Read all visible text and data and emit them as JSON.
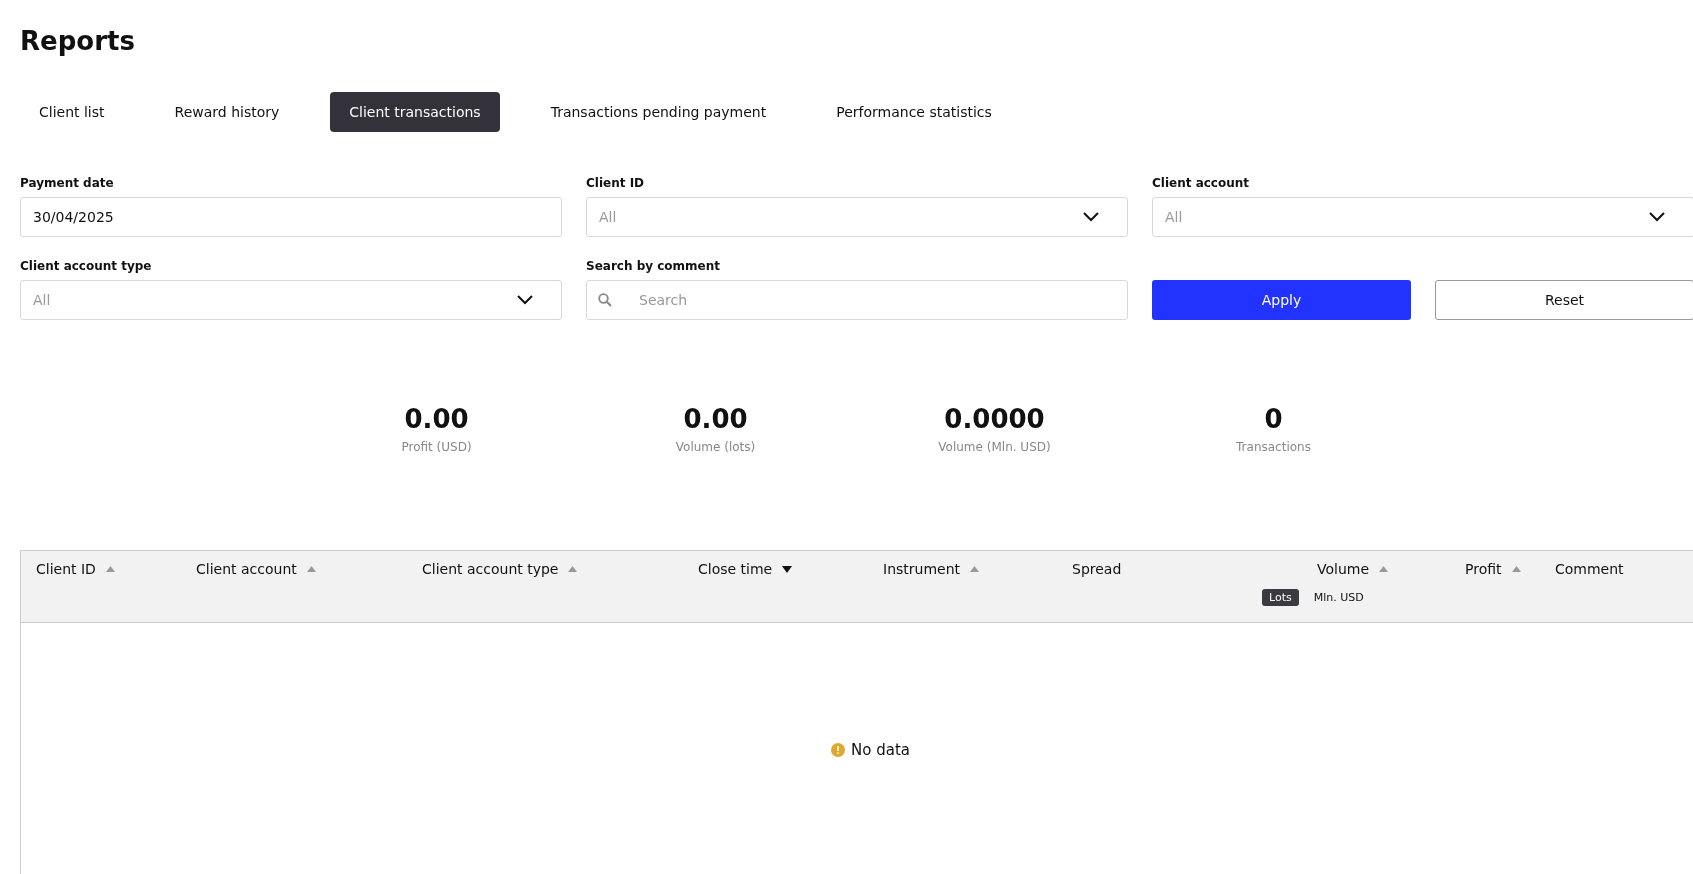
{
  "page_title": "Reports",
  "tabs": [
    {
      "label": "Client list",
      "selected": false
    },
    {
      "label": "Reward history",
      "selected": false
    },
    {
      "label": "Client transactions",
      "selected": true
    },
    {
      "label": "Transactions pending payment",
      "selected": false
    },
    {
      "label": "Performance statistics",
      "selected": false
    }
  ],
  "filters": [
    {
      "kind": "text",
      "label": "Payment date",
      "value": "30/04/2025"
    },
    {
      "kind": "select",
      "label": "Client ID",
      "placeholder": "All"
    },
    {
      "kind": "select",
      "label": "Client account",
      "placeholder": "All"
    },
    {
      "kind": "select",
      "label": "Client account type",
      "placeholder": "All"
    },
    {
      "kind": "search",
      "label": "Search by comment",
      "placeholder": "Search"
    }
  ],
  "buttons": [
    {
      "kind": "primary",
      "label": "Apply"
    },
    {
      "kind": "secondary",
      "label": "Reset"
    }
  ],
  "stats": [
    {
      "value": "0.00",
      "label": "Profit (USD)"
    },
    {
      "value": "0.00",
      "label": "Volume (lots)"
    },
    {
      "value": "0.0000",
      "label": "Volume (Mln. USD)"
    },
    {
      "value": "0",
      "label": "Transactions"
    }
  ],
  "table": {
    "columns": [
      {
        "label": "Client ID",
        "sortable": true,
        "sorted": false
      },
      {
        "label": "Client account",
        "sortable": true,
        "sorted": false
      },
      {
        "label": "Client account type",
        "sortable": true,
        "sorted": false
      },
      {
        "label": "Close time",
        "sortable": true,
        "sorted": true
      },
      {
        "label": "Instrument",
        "sortable": true,
        "sorted": false
      },
      {
        "label": "Spread",
        "sortable": false
      },
      {
        "label": "Volume",
        "sortable": true,
        "sorted": false,
        "units": [
          {
            "label": "Lots",
            "selected": true
          },
          {
            "label": "Mln. USD",
            "selected": false
          }
        ]
      },
      {
        "label": "Profit",
        "sortable": true,
        "sorted": false
      },
      {
        "label": "Comment",
        "sortable": false
      }
    ],
    "empty_message": "No data"
  }
}
